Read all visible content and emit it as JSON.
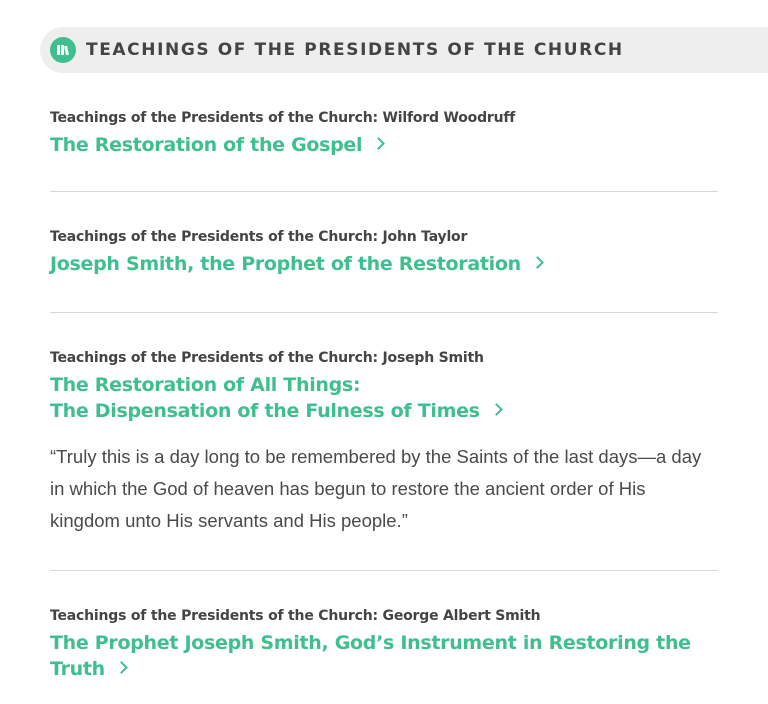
{
  "section": {
    "title": "TEACHINGS OF THE PRESIDENTS OF THE CHURCH",
    "icon": "book-icon",
    "accent_color": "#3fbf8f"
  },
  "entries": [
    {
      "source": "Teachings of the Presidents of the Church: Wilford Woodruff",
      "title": "The Restoration of the Gospel"
    },
    {
      "source": "Teachings of the Presidents of the Church: John Taylor",
      "title": "Joseph Smith, the Prophet of the Restoration"
    },
    {
      "source": "Teachings of the Presidents of the Church: Joseph Smith",
      "title_line1": "The Restoration of All Things:",
      "title_line2": "The Dispensation of the Fulness of Times",
      "quote": "“Truly this is a day long to be remembered by the Saints of the last days—a day in which the God of heaven has begun to restore the ancient order of His kingdom unto His servants and His people.”"
    },
    {
      "source": "Teachings of the Presidents of the Church: George Albert Smith",
      "title_line1": "The Prophet Joseph Smith, God’s Instrument in Restoring the",
      "title_line2": "Truth"
    }
  ]
}
